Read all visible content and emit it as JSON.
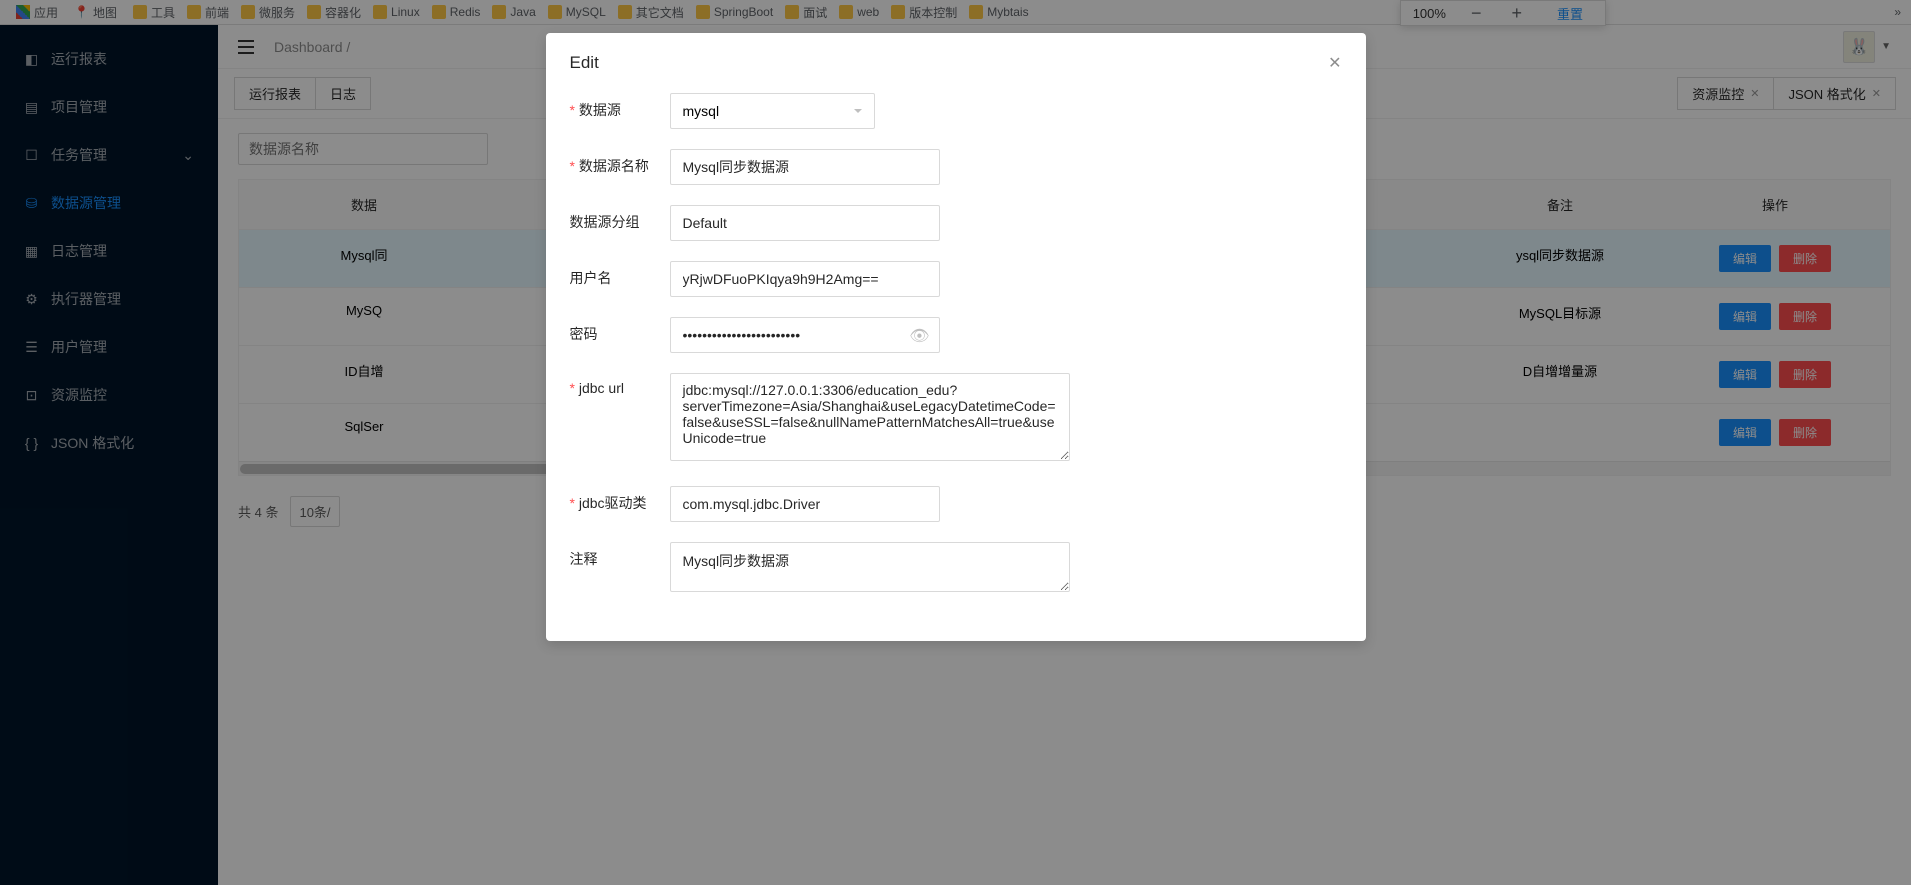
{
  "bookmarks": {
    "apps": "应用",
    "maps": "地图",
    "items": [
      "工具",
      "前端",
      "微服务",
      "容器化",
      "Linux",
      "Redis",
      "Java",
      "MySQL",
      "其它文档",
      "SpringBoot",
      "面试",
      "web",
      "版本控制",
      "Mybtais"
    ]
  },
  "zoom": {
    "level": "100%",
    "reset": "重置"
  },
  "sidebar": {
    "items": [
      {
        "label": "运行报表",
        "icon": "dashboard"
      },
      {
        "label": "项目管理",
        "icon": "project"
      },
      {
        "label": "任务管理",
        "icon": "task",
        "hasSub": true
      },
      {
        "label": "数据源管理",
        "icon": "database",
        "active": true
      },
      {
        "label": "日志管理",
        "icon": "log"
      },
      {
        "label": "执行器管理",
        "icon": "executor"
      },
      {
        "label": "用户管理",
        "icon": "user"
      },
      {
        "label": "资源监控",
        "icon": "monitor"
      },
      {
        "label": "JSON 格式化",
        "icon": "json"
      }
    ]
  },
  "breadcrumb": "Dashboard  /",
  "tabs": {
    "left": [
      "运行报表",
      "日志"
    ],
    "right": [
      {
        "label": "资源监控",
        "closable": true
      },
      {
        "label": "JSON 格式化",
        "closable": true
      }
    ]
  },
  "search": {
    "placeholder": "数据源名称"
  },
  "table": {
    "headers": {
      "name": "数据",
      "note": "备注",
      "op": "操作"
    },
    "rows": [
      {
        "name": "Mysql同",
        "note": "ysql同步数据源",
        "selected": true
      },
      {
        "name": "MySQ",
        "note": "MySQL目标源"
      },
      {
        "name": "ID自增",
        "note": "D自增增量源"
      },
      {
        "name": "SqlSer",
        "note": ""
      }
    ],
    "editBtn": "编辑",
    "delBtn": "删除"
  },
  "pagination": {
    "total": "共 4 条",
    "pageSize": "10条/"
  },
  "modal": {
    "title": "Edit",
    "fields": {
      "datasource": {
        "label": "数据源",
        "value": "mysql"
      },
      "dsName": {
        "label": "数据源名称",
        "value": "Mysql同步数据源"
      },
      "dsGroup": {
        "label": "数据源分组",
        "value": "Default"
      },
      "username": {
        "label": "用户名",
        "value": "yRjwDFuoPKIqya9h9H2Amg=="
      },
      "password": {
        "label": "密码",
        "value": "••••••••••••••••••••••••"
      },
      "jdbcUrl": {
        "label": "jdbc url",
        "value": "jdbc:mysql://127.0.0.1:3306/education_edu?serverTimezone=Asia/Shanghai&useLegacyDatetimeCode=false&useSSL=false&nullNamePatternMatchesAll=true&useUnicode=true"
      },
      "jdbcDriver": {
        "label": "jdbc驱动类",
        "value": "com.mysql.jdbc.Driver"
      },
      "comment": {
        "label": "注释",
        "value": "Mysql同步数据源"
      }
    }
  }
}
